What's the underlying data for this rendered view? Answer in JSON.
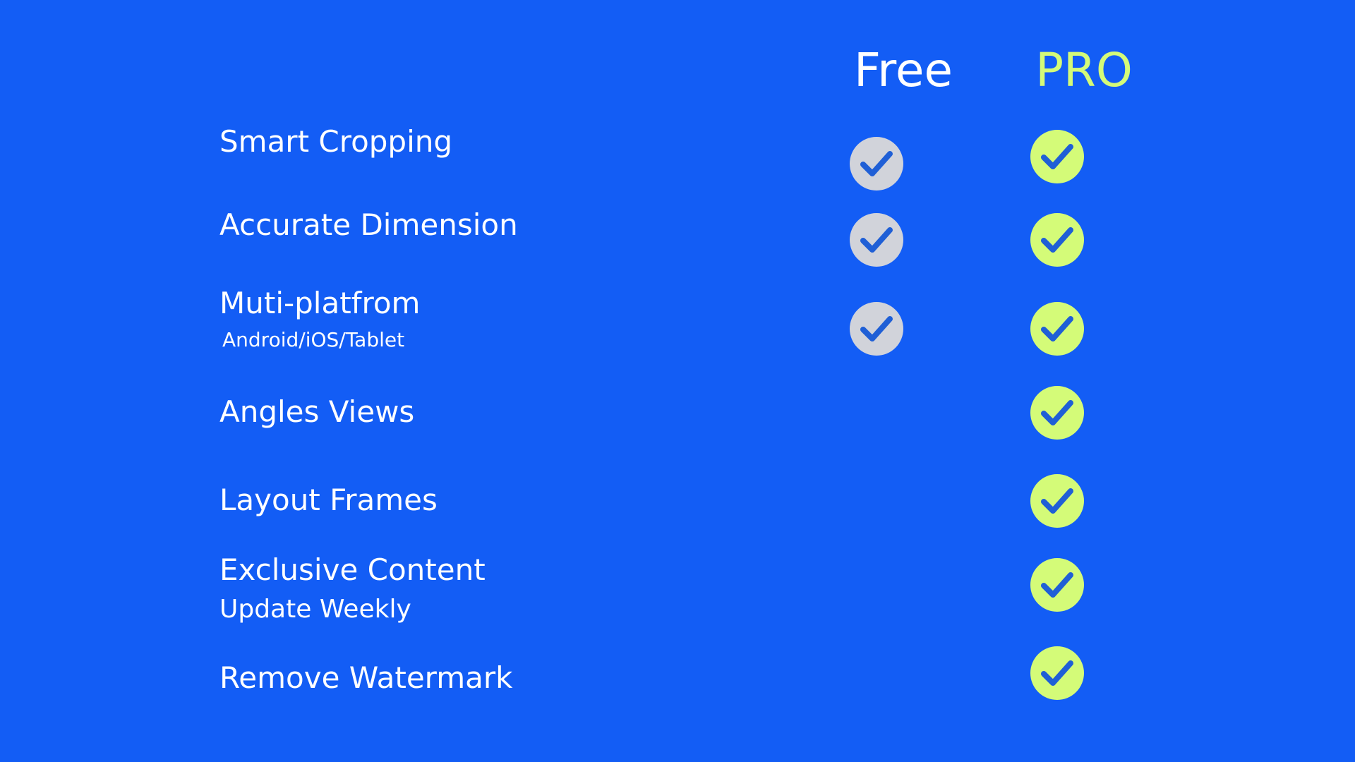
{
  "colors": {
    "background": "#135DF5",
    "pro_accent": "#D4FB78",
    "free_check": "#D1D3DA",
    "check_mark": "#1F5FD6",
    "text": "#FFFFFF"
  },
  "columns": {
    "free": {
      "label": "Free"
    },
    "pro": {
      "label": "PRO"
    }
  },
  "features": [
    {
      "label": "Smart Cropping",
      "sublabel": "",
      "free": true,
      "pro": true
    },
    {
      "label": "Accurate Dimension",
      "sublabel": "",
      "free": true,
      "pro": true
    },
    {
      "label": "Muti-platfrom",
      "sublabel": "Android/iOS/Tablet",
      "free": true,
      "pro": true
    },
    {
      "label": "Angles Views",
      "sublabel": "",
      "free": false,
      "pro": true
    },
    {
      "label": "Layout Frames",
      "sublabel": "",
      "free": false,
      "pro": true
    },
    {
      "label": "Exclusive Content",
      "sublabel": "Update Weekly",
      "free": false,
      "pro": true
    },
    {
      "label": "Remove Watermark",
      "sublabel": "",
      "free": false,
      "pro": true
    }
  ],
  "icons": {
    "check": "check-circle-icon"
  }
}
